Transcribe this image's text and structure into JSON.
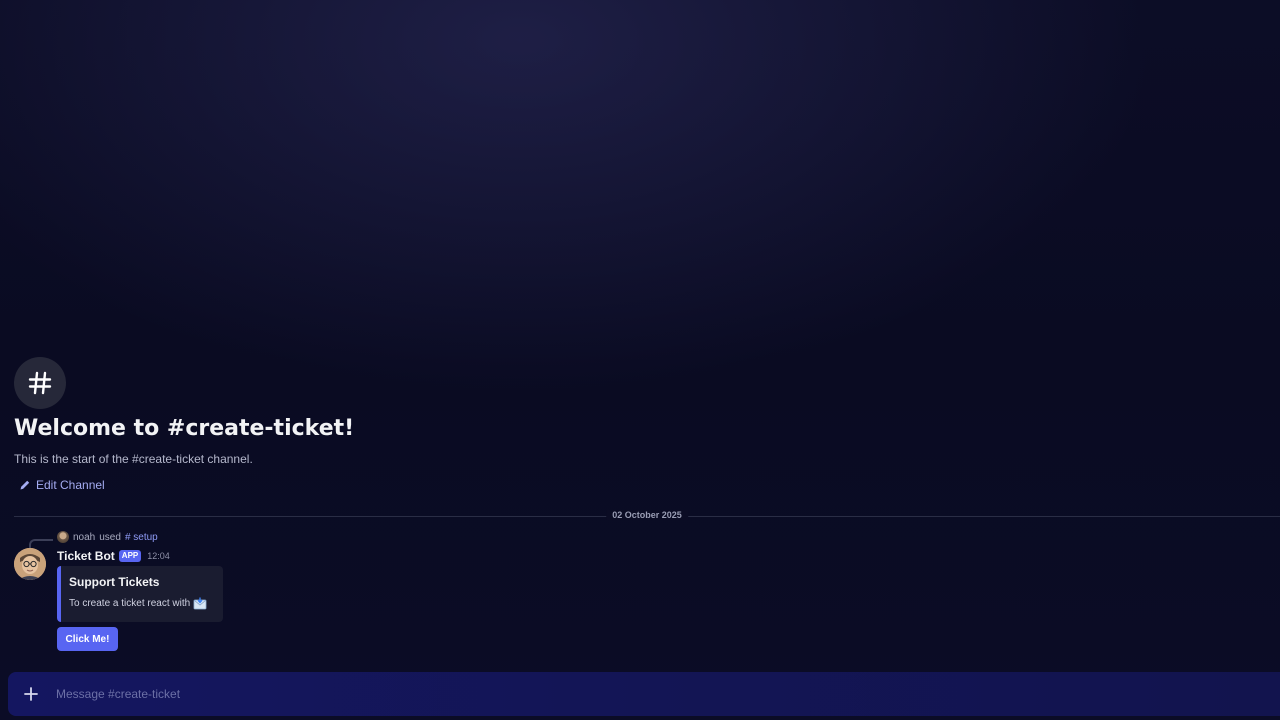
{
  "channel": {
    "welcome_title": "Welcome to #create-ticket!",
    "welcome_subtitle": "This is the start of the #create-ticket channel.",
    "edit_label": "Edit Channel",
    "icon": "hash-icon"
  },
  "divider": {
    "date": "02 October 2025"
  },
  "message": {
    "reference": {
      "user": "noah",
      "verb": "used",
      "command": "# setup"
    },
    "author": "Ticket Bot",
    "badge": "APP",
    "time": "12:04",
    "embed": {
      "title": "Support Tickets",
      "description": "To create a ticket react with",
      "emoji": "envelope-with-arrow-icon"
    },
    "button_label": "Click Me!"
  },
  "composer": {
    "placeholder": "Message #create-ticket",
    "icon": "plus-icon"
  },
  "colors": {
    "accent": "#5865f2",
    "link": "#a4acf2",
    "background": "#0b0c24",
    "composer": "#141660"
  }
}
